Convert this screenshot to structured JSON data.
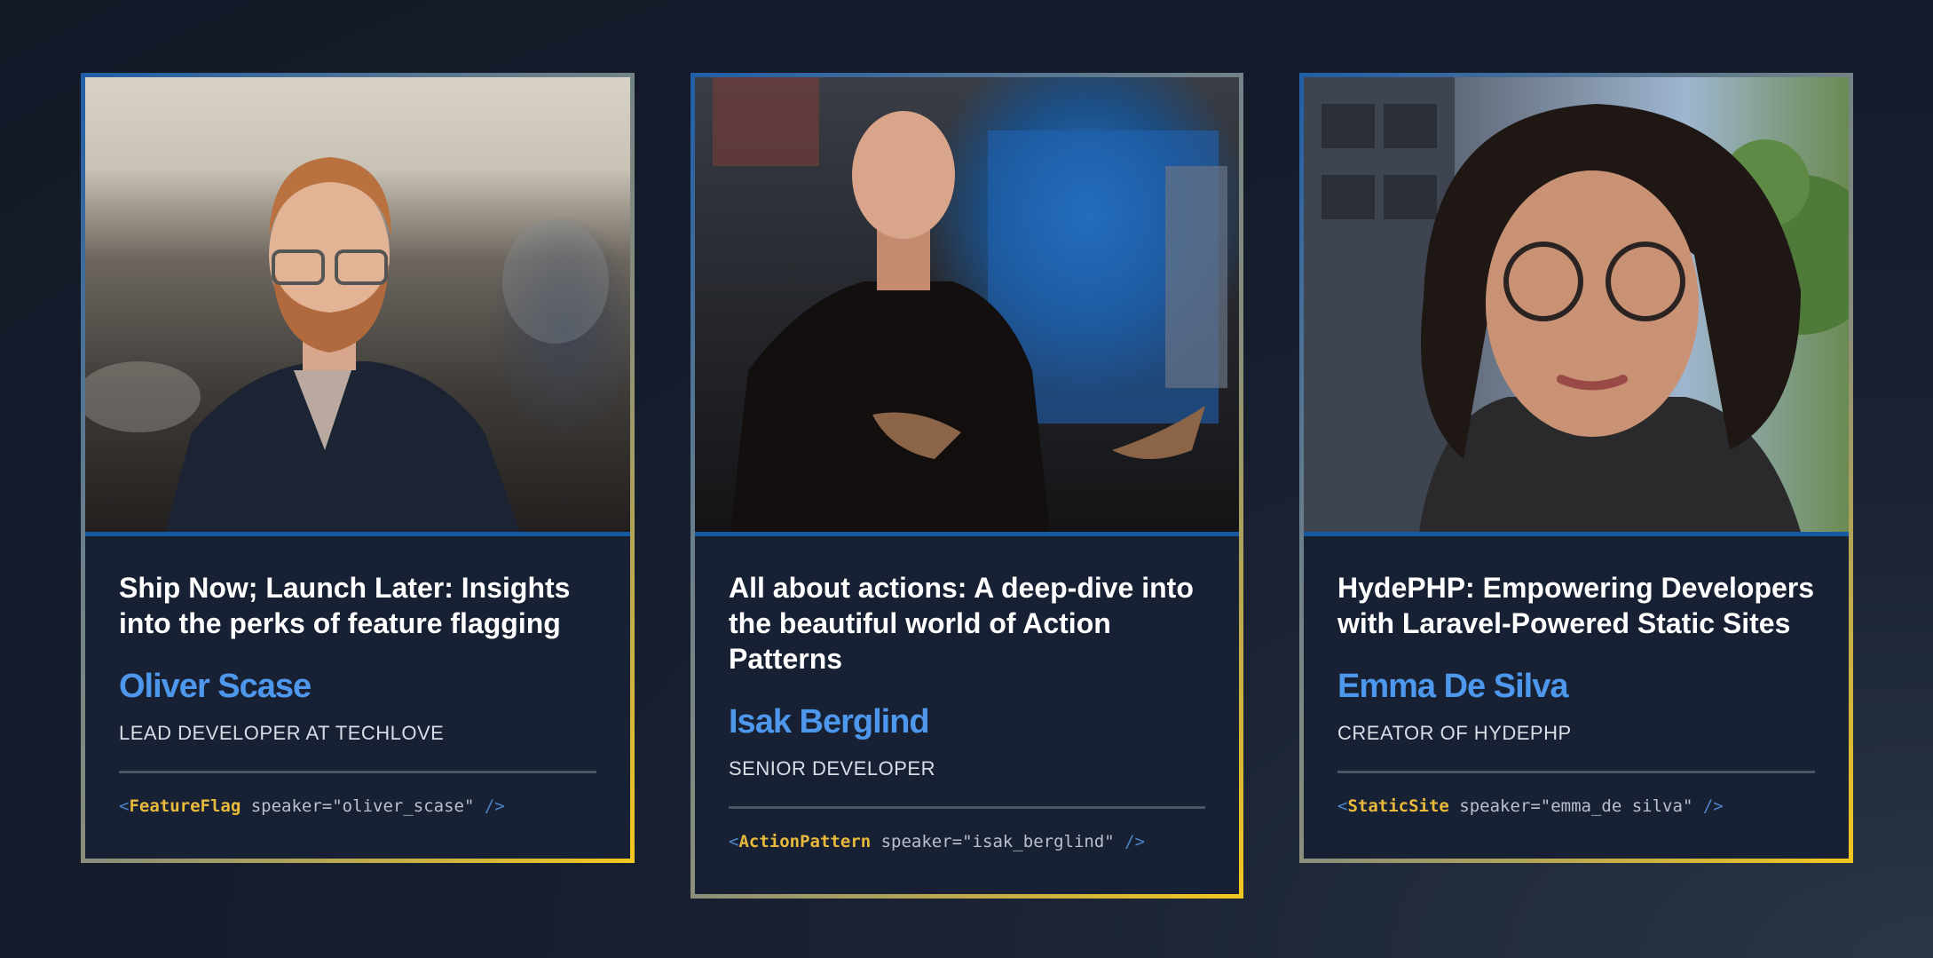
{
  "cards": [
    {
      "title": "Ship Now; Launch Later: Insights into the perks of feature flagging",
      "speaker": "Oliver Scase",
      "role": "LEAD DEVELOPER AT TECHLOVE",
      "code": {
        "open": "<",
        "tag": "FeatureFlag",
        "attr": " speaker=\"oliver_scase\" ",
        "close": "/>"
      }
    },
    {
      "title": "All about actions: A deep-dive into the beautiful world of Action Patterns",
      "speaker": "Isak Berglind",
      "role": "SENIOR DEVELOPER",
      "code": {
        "open": "<",
        "tag": "ActionPattern",
        "attr": " speaker=\"isak_berglind\" ",
        "close": "/>"
      }
    },
    {
      "title": "HydePHP: Empowering Developers with Laravel-Powered Static Sites",
      "speaker": "Emma De Silva",
      "role": "CREATOR OF HYDEPHP",
      "code": {
        "open": "<",
        "tag": "StaticSite",
        "attr": " speaker=\"emma_de silva\" ",
        "close": "/>"
      }
    }
  ],
  "colors": {
    "accent": "#4d97ec",
    "tag": "#e9b93c",
    "card_bg": "#182133",
    "border_blue": "#155aa3",
    "border_gold": "#f2c71e"
  }
}
